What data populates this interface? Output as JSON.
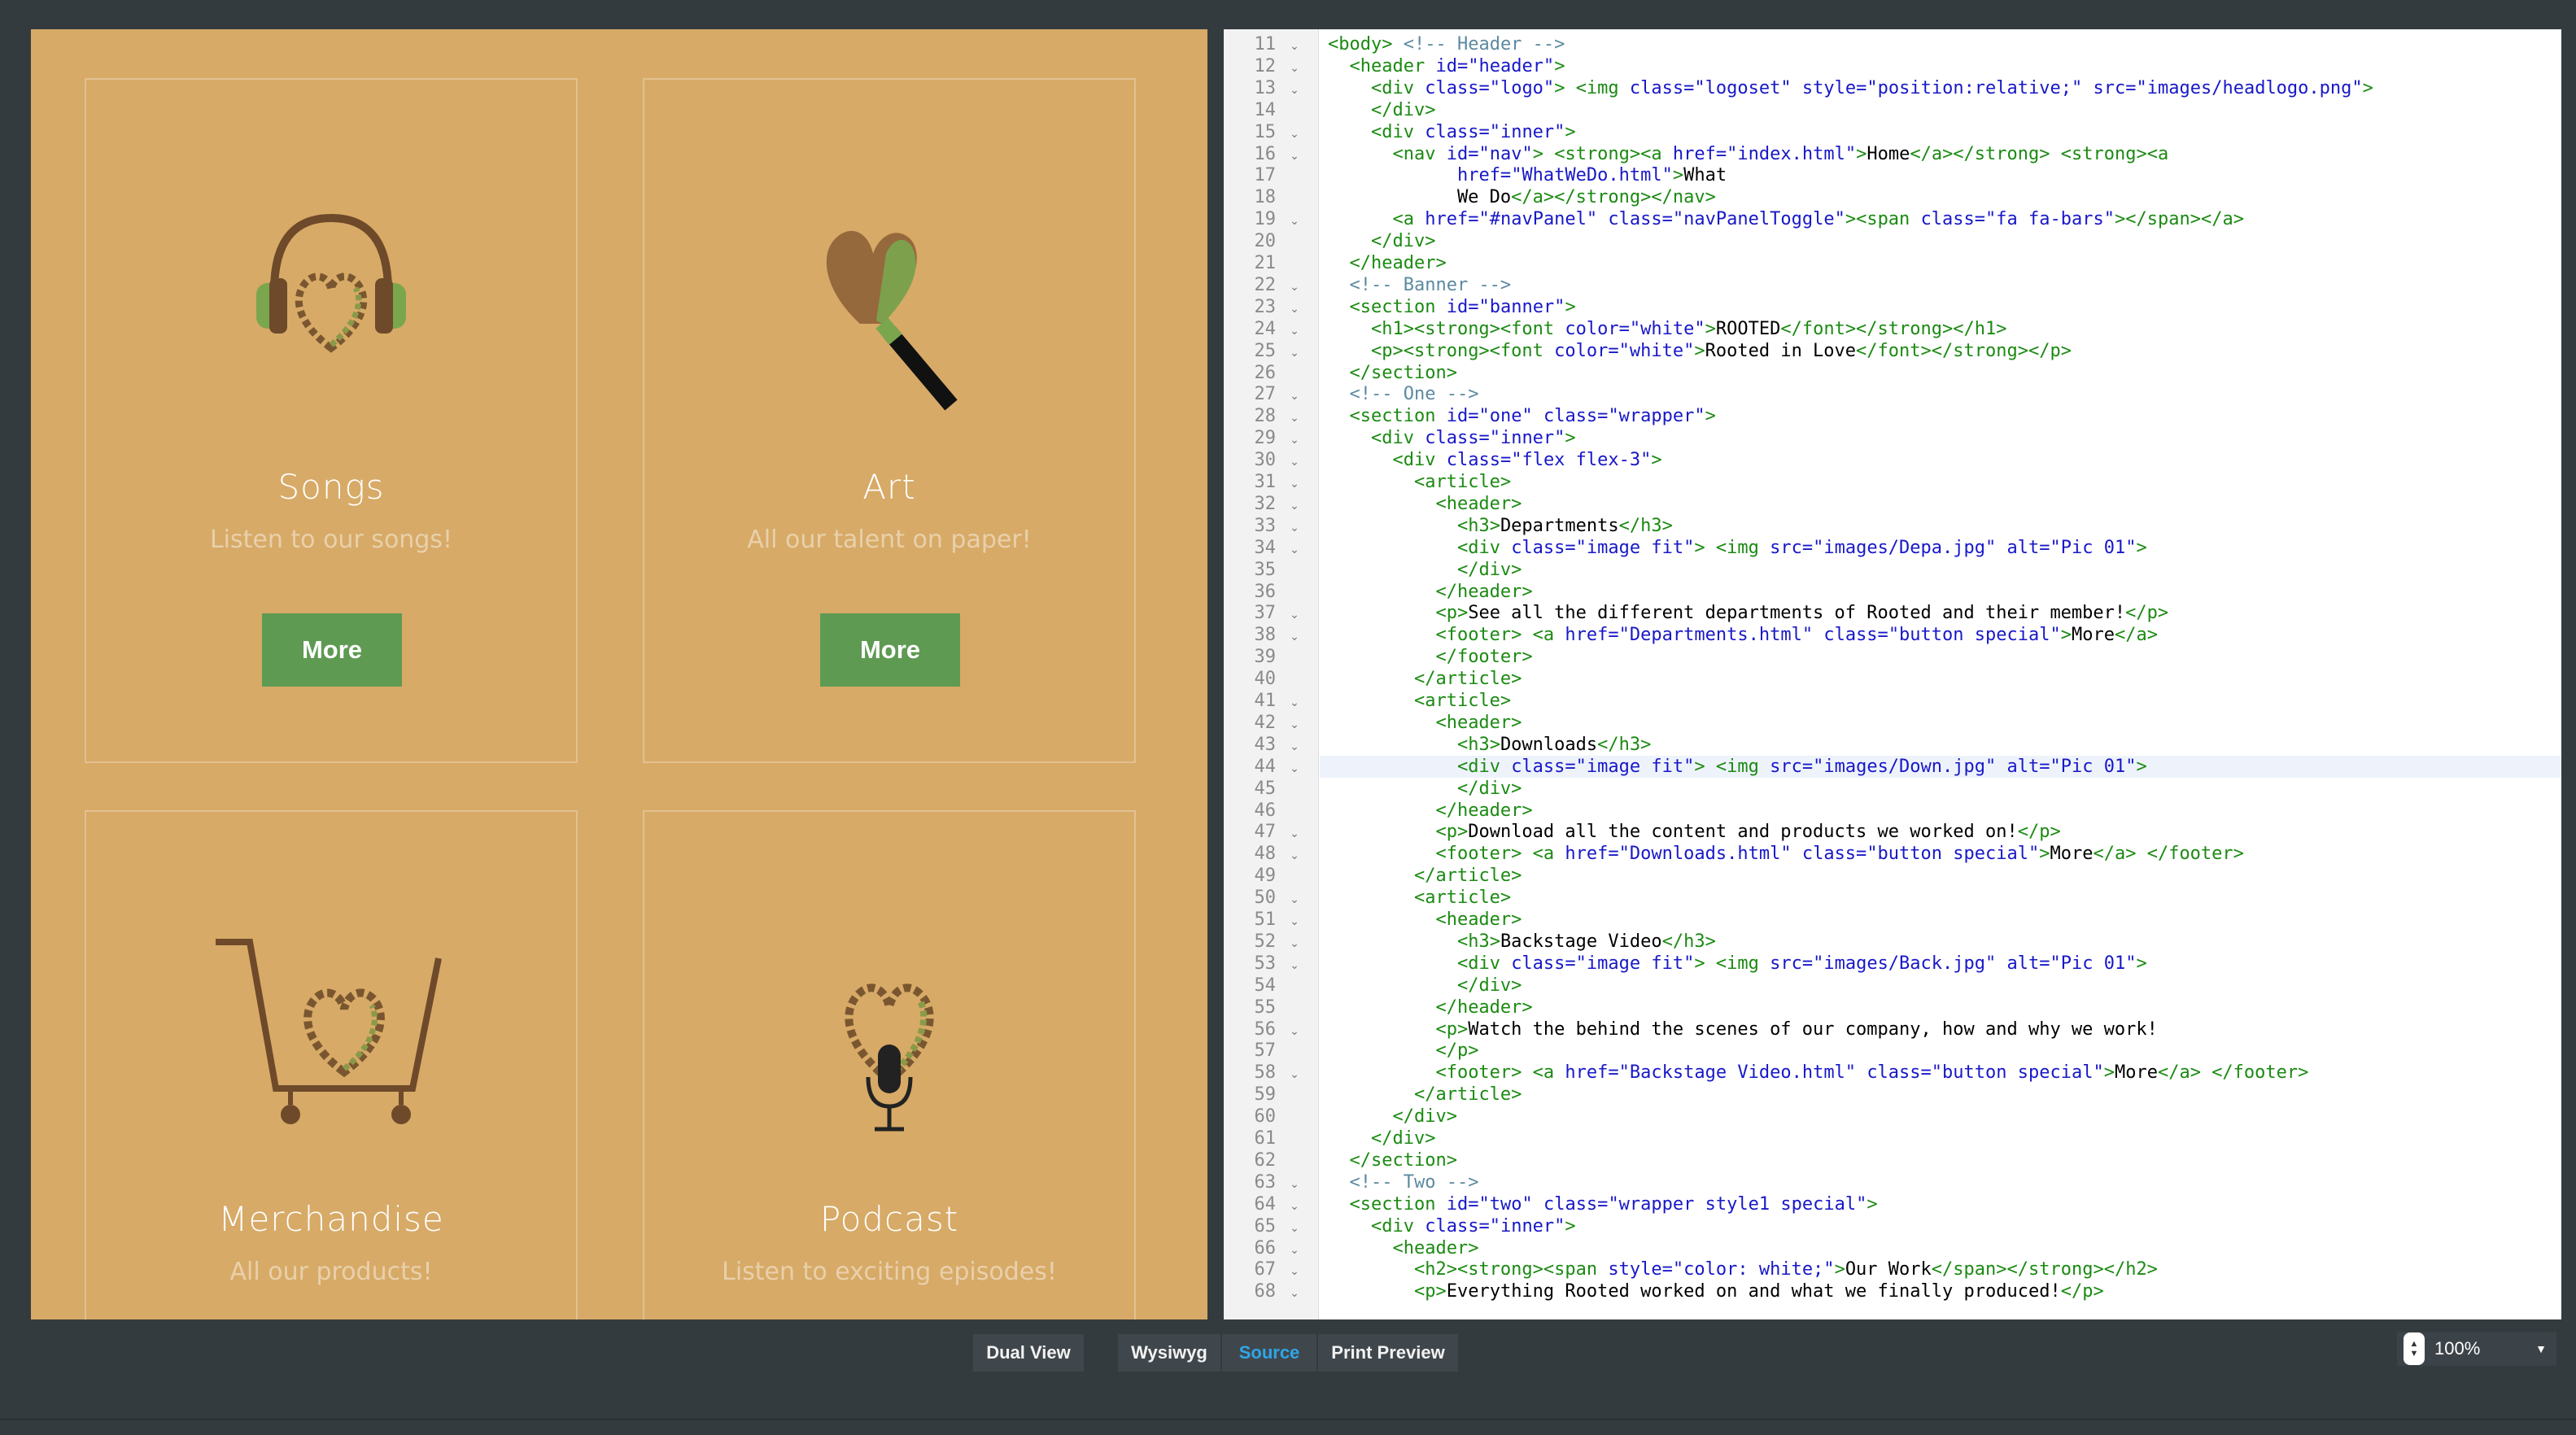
{
  "preview": {
    "cards": [
      {
        "title": "Songs",
        "subtitle": "Listen to our songs!",
        "button": "More",
        "icon": "headphones-heart-icon"
      },
      {
        "title": "Art",
        "subtitle": "All our talent on paper!",
        "button": "More",
        "icon": "brush-heart-icon"
      },
      {
        "title": "Merchandise",
        "subtitle": "All our products!",
        "icon": "cart-heart-icon"
      },
      {
        "title": "Podcast",
        "subtitle": "Listen to exciting episodes!",
        "icon": "microphone-heart-icon"
      }
    ]
  },
  "editor": {
    "highlighted_line": 44,
    "lines": [
      {
        "n": "11",
        "f": true,
        "h": "<span class=\"t\">&lt;body&gt;</span> <span class=\"c\">&lt;!-- Header --&gt;</span>"
      },
      {
        "n": "12",
        "f": true,
        "h": "  <span class=\"t\">&lt;header</span> <span class=\"a\">id=</span><span class=\"v\">\"header\"</span><span class=\"t\">&gt;</span>"
      },
      {
        "n": "13",
        "f": true,
        "h": "    <span class=\"t\">&lt;div</span> <span class=\"a\">class=</span><span class=\"v\">\"logo\"</span><span class=\"t\">&gt;</span> <span class=\"t\">&lt;img</span> <span class=\"a\">class=</span><span class=\"v\">\"logoset\"</span> <span class=\"a\">style=</span><span class=\"v\">\"position:relative;\"</span> <span class=\"a\">src=</span><span class=\"v\">\"images/headlogo.png\"</span><span class=\"t\">&gt;</span>"
      },
      {
        "n": "14",
        "f": false,
        "h": "    <span class=\"t\">&lt;/div&gt;</span>"
      },
      {
        "n": "15",
        "f": true,
        "h": "    <span class=\"t\">&lt;div</span> <span class=\"a\">class=</span><span class=\"v\">\"inner\"</span><span class=\"t\">&gt;</span>"
      },
      {
        "n": "16",
        "f": true,
        "h": "      <span class=\"t\">&lt;nav</span> <span class=\"a\">id=</span><span class=\"v\">\"nav\"</span><span class=\"t\">&gt;</span> <span class=\"t\">&lt;strong&gt;&lt;a</span> <span class=\"a\">href=</span><span class=\"v\">\"index.html\"</span><span class=\"t\">&gt;</span>Home<span class=\"t\">&lt;/a&gt;&lt;/strong&gt;</span> <span class=\"t\">&lt;strong&gt;&lt;a</span>"
      },
      {
        "n": "17",
        "f": false,
        "h": "            <span class=\"a\">href=</span><span class=\"v\">\"WhatWeDo.html\"</span><span class=\"t\">&gt;</span>What"
      },
      {
        "n": "18",
        "f": false,
        "h": "            We Do<span class=\"t\">&lt;/a&gt;&lt;/strong&gt;&lt;/nav&gt;</span>"
      },
      {
        "n": "19",
        "f": true,
        "h": "      <span class=\"t\">&lt;a</span> <span class=\"a\">href=</span><span class=\"v\">\"#navPanel\"</span> <span class=\"a\">class=</span><span class=\"v\">\"navPanelToggle\"</span><span class=\"t\">&gt;&lt;span</span> <span class=\"a\">class=</span><span class=\"v\">\"fa fa-bars\"</span><span class=\"t\">&gt;&lt;/span&gt;&lt;/a&gt;</span>"
      },
      {
        "n": "20",
        "f": false,
        "h": "    <span class=\"t\">&lt;/div&gt;</span>"
      },
      {
        "n": "21",
        "f": false,
        "h": "  <span class=\"t\">&lt;/header&gt;</span>"
      },
      {
        "n": "22",
        "f": true,
        "h": "  <span class=\"c\">&lt;!-- Banner --&gt;</span>"
      },
      {
        "n": "23",
        "f": true,
        "h": "  <span class=\"t\">&lt;section</span> <span class=\"a\">id=</span><span class=\"v\">\"banner\"</span><span class=\"t\">&gt;</span>"
      },
      {
        "n": "24",
        "f": true,
        "h": "    <span class=\"t\">&lt;h1&gt;&lt;strong&gt;&lt;font</span> <span class=\"a\">color=</span><span class=\"v\">\"white\"</span><span class=\"t\">&gt;</span>ROOTED<span class=\"t\">&lt;/font&gt;&lt;/strong&gt;&lt;/h1&gt;</span>"
      },
      {
        "n": "25",
        "f": true,
        "h": "    <span class=\"t\">&lt;p&gt;&lt;strong&gt;&lt;font</span> <span class=\"a\">color=</span><span class=\"v\">\"white\"</span><span class=\"t\">&gt;</span>Rooted in Love<span class=\"t\">&lt;/font&gt;&lt;/strong&gt;&lt;/p&gt;</span>"
      },
      {
        "n": "26",
        "f": false,
        "h": "  <span class=\"t\">&lt;/section&gt;</span>"
      },
      {
        "n": "27",
        "f": true,
        "h": "  <span class=\"c\">&lt;!-- One --&gt;</span>"
      },
      {
        "n": "28",
        "f": true,
        "h": "  <span class=\"t\">&lt;section</span> <span class=\"a\">id=</span><span class=\"v\">\"one\"</span> <span class=\"a\">class=</span><span class=\"v\">\"wrapper\"</span><span class=\"t\">&gt;</span>"
      },
      {
        "n": "29",
        "f": true,
        "h": "    <span class=\"t\">&lt;div</span> <span class=\"a\">class=</span><span class=\"v\">\"inner\"</span><span class=\"t\">&gt;</span>"
      },
      {
        "n": "30",
        "f": true,
        "h": "      <span class=\"t\">&lt;div</span> <span class=\"a\">class=</span><span class=\"v\">\"flex flex-3\"</span><span class=\"t\">&gt;</span>"
      },
      {
        "n": "31",
        "f": true,
        "h": "        <span class=\"t\">&lt;article&gt;</span>"
      },
      {
        "n": "32",
        "f": true,
        "h": "          <span class=\"t\">&lt;header&gt;</span>"
      },
      {
        "n": "33",
        "f": true,
        "h": "            <span class=\"t\">&lt;h3&gt;</span>Departments<span class=\"t\">&lt;/h3&gt;</span>"
      },
      {
        "n": "34",
        "f": true,
        "h": "            <span class=\"t\">&lt;div</span> <span class=\"a\">class=</span><span class=\"v\">\"image fit\"</span><span class=\"t\">&gt;</span> <span class=\"t\">&lt;img</span> <span class=\"a\">src=</span><span class=\"v\">\"images/Depa.jpg\"</span> <span class=\"a\">alt=</span><span class=\"v\">\"Pic 01\"</span><span class=\"t\">&gt;</span>"
      },
      {
        "n": "35",
        "f": false,
        "h": "            <span class=\"t\">&lt;/div&gt;</span>"
      },
      {
        "n": "36",
        "f": false,
        "h": "          <span class=\"t\">&lt;/header&gt;</span>"
      },
      {
        "n": "37",
        "f": true,
        "h": "          <span class=\"t\">&lt;p&gt;</span>See all the different departments of Rooted and their member!<span class=\"t\">&lt;/p&gt;</span>"
      },
      {
        "n": "38",
        "f": true,
        "h": "          <span class=\"t\">&lt;footer&gt;</span> <span class=\"t\">&lt;a</span> <span class=\"a\">href=</span><span class=\"v\">\"Departments.html\"</span> <span class=\"a\">class=</span><span class=\"v\">\"button special\"</span><span class=\"t\">&gt;</span>More<span class=\"t\">&lt;/a&gt;</span>"
      },
      {
        "n": "39",
        "f": false,
        "h": "          <span class=\"t\">&lt;/footer&gt;</span>"
      },
      {
        "n": "40",
        "f": false,
        "h": "        <span class=\"t\">&lt;/article&gt;</span>"
      },
      {
        "n": "41",
        "f": true,
        "h": "        <span class=\"t\">&lt;article&gt;</span>"
      },
      {
        "n": "42",
        "f": true,
        "h": "          <span class=\"t\">&lt;header&gt;</span>"
      },
      {
        "n": "43",
        "f": true,
        "h": "            <span class=\"t\">&lt;h3&gt;</span>Downloads<span class=\"t\">&lt;/h3&gt;</span>"
      },
      {
        "n": "44",
        "f": true,
        "h": "            <span class=\"t\">&lt;div</span> <span class=\"a\">class=</span><span class=\"v\">\"image fit\"</span><span class=\"t\">&gt;</span> <span class=\"t\">&lt;img</span> <span class=\"a\">src=</span><span class=\"v\">\"images/Down.jpg\"</span> <span class=\"a\">alt=</span><span class=\"v\">\"Pic 01\"</span><span class=\"t\">&gt;</span>"
      },
      {
        "n": "45",
        "f": false,
        "h": "            <span class=\"t\">&lt;/div&gt;</span>"
      },
      {
        "n": "46",
        "f": false,
        "h": "          <span class=\"t\">&lt;/header&gt;</span>"
      },
      {
        "n": "47",
        "f": true,
        "h": "          <span class=\"t\">&lt;p&gt;</span>Download all the content and products we worked on!<span class=\"t\">&lt;/p&gt;</span>"
      },
      {
        "n": "48",
        "f": true,
        "h": "          <span class=\"t\">&lt;footer&gt;</span> <span class=\"t\">&lt;a</span> <span class=\"a\">href=</span><span class=\"v\">\"Downloads.html\"</span> <span class=\"a\">class=</span><span class=\"v\">\"button special\"</span><span class=\"t\">&gt;</span>More<span class=\"t\">&lt;/a&gt;</span> <span class=\"t\">&lt;/footer&gt;</span>"
      },
      {
        "n": "49",
        "f": false,
        "h": "        <span class=\"t\">&lt;/article&gt;</span>"
      },
      {
        "n": "50",
        "f": true,
        "h": "        <span class=\"t\">&lt;article&gt;</span>"
      },
      {
        "n": "51",
        "f": true,
        "h": "          <span class=\"t\">&lt;header&gt;</span>"
      },
      {
        "n": "52",
        "f": true,
        "h": "            <span class=\"t\">&lt;h3&gt;</span>Backstage Video<span class=\"t\">&lt;/h3&gt;</span>"
      },
      {
        "n": "53",
        "f": true,
        "h": "            <span class=\"t\">&lt;div</span> <span class=\"a\">class=</span><span class=\"v\">\"image fit\"</span><span class=\"t\">&gt;</span> <span class=\"t\">&lt;img</span> <span class=\"a\">src=</span><span class=\"v\">\"images/Back.jpg\"</span> <span class=\"a\">alt=</span><span class=\"v\">\"Pic 01\"</span><span class=\"t\">&gt;</span>"
      },
      {
        "n": "54",
        "f": false,
        "h": "            <span class=\"t\">&lt;/div&gt;</span>"
      },
      {
        "n": "55",
        "f": false,
        "h": "          <span class=\"t\">&lt;/header&gt;</span>"
      },
      {
        "n": "56",
        "f": true,
        "h": "          <span class=\"t\">&lt;p&gt;</span>Watch the behind the scenes of our company, how and why we work!"
      },
      {
        "n": "57",
        "f": false,
        "h": "          <span class=\"t\">&lt;/p&gt;</span>"
      },
      {
        "n": "58",
        "f": true,
        "h": "          <span class=\"t\">&lt;footer&gt;</span> <span class=\"t\">&lt;a</span> <span class=\"a\">href=</span><span class=\"v\">\"Backstage Video.html\"</span> <span class=\"a\">class=</span><span class=\"v\">\"button special\"</span><span class=\"t\">&gt;</span>More<span class=\"t\">&lt;/a&gt;</span> <span class=\"t\">&lt;/footer&gt;</span>"
      },
      {
        "n": "59",
        "f": false,
        "h": "        <span class=\"t\">&lt;/article&gt;</span>"
      },
      {
        "n": "60",
        "f": false,
        "h": "      <span class=\"t\">&lt;/div&gt;</span>"
      },
      {
        "n": "61",
        "f": false,
        "h": "    <span class=\"t\">&lt;/div&gt;</span>"
      },
      {
        "n": "62",
        "f": false,
        "h": "  <span class=\"t\">&lt;/section&gt;</span>"
      },
      {
        "n": "63",
        "f": true,
        "h": "  <span class=\"c\">&lt;!-- Two --&gt;</span>"
      },
      {
        "n": "64",
        "f": true,
        "h": "  <span class=\"t\">&lt;section</span> <span class=\"a\">id=</span><span class=\"v\">\"two\"</span> <span class=\"a\">class=</span><span class=\"v\">\"wrapper style1 special\"</span><span class=\"t\">&gt;</span>"
      },
      {
        "n": "65",
        "f": true,
        "h": "    <span class=\"t\">&lt;div</span> <span class=\"a\">class=</span><span class=\"v\">\"inner\"</span><span class=\"t\">&gt;</span>"
      },
      {
        "n": "66",
        "f": true,
        "h": "      <span class=\"t\">&lt;header&gt;</span>"
      },
      {
        "n": "67",
        "f": true,
        "h": "        <span class=\"t\">&lt;h2&gt;&lt;strong&gt;&lt;span</span> <span class=\"a\">style=</span><span class=\"v\">\"color: white;\"</span><span class=\"t\">&gt;</span>Our Work<span class=\"t\">&lt;/span&gt;&lt;/strong&gt;&lt;/h2&gt;</span>"
      },
      {
        "n": "68",
        "f": true,
        "h": "        <span class=\"t\">&lt;p&gt;</span>Everything Rooted worked on and what we finally produced!<span class=\"t\">&lt;/p&gt;</span>"
      }
    ]
  },
  "toolbar": {
    "dual_view": "Dual View",
    "wysiwyg": "Wysiwyg",
    "source": "Source",
    "print_preview": "Print Preview",
    "active_tab": "Source",
    "zoom": "100%"
  },
  "colors": {
    "preview_bg": "#d7aa67",
    "button_green": "#5f9a52",
    "tag_green": "#1b8a12",
    "attr_blue": "#1818c8",
    "active_blue": "#2ea6e8"
  }
}
